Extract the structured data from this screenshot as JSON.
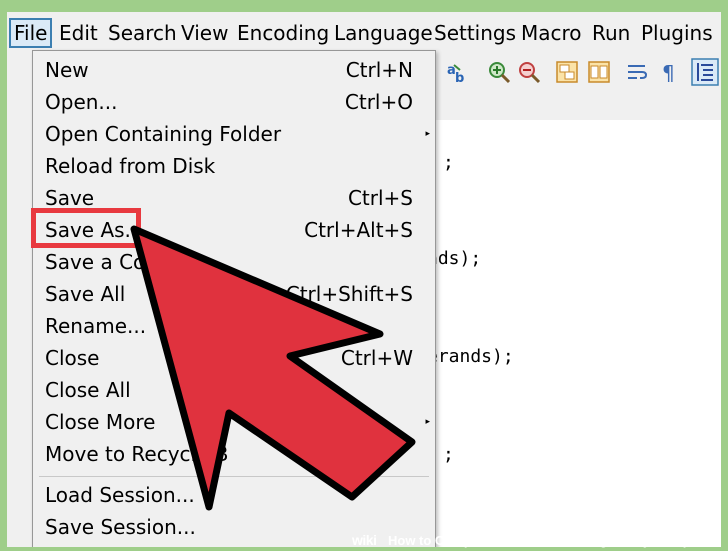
{
  "menubar": {
    "items": [
      "File",
      "Edit",
      "Search",
      "View",
      "Encoding",
      "Language",
      "Settings",
      "Macro",
      "Run",
      "Plugins"
    ],
    "active": "File"
  },
  "toolbar": {
    "icons": [
      "find-replace-icon",
      "zoom-in-icon",
      "zoom-out-icon",
      "sync-vertical-icon",
      "sync-horizontal-icon",
      "word-wrap-icon",
      "show-all-characters-icon",
      "indent-guide-icon"
    ]
  },
  "editor": {
    "lines": [
      ";",
      "nds);",
      "erands);",
      ";"
    ]
  },
  "file_menu": {
    "items": [
      {
        "label": "New",
        "shortcut": "Ctrl+N"
      },
      {
        "label": "Open...",
        "shortcut": "Ctrl+O"
      },
      {
        "label": "Open Containing Folder",
        "shortcut": "",
        "submenu": "▸"
      },
      {
        "label": "Reload from Disk",
        "shortcut": ""
      },
      {
        "label": "Save",
        "shortcut": "Ctrl+S"
      },
      {
        "label": "Save As...",
        "shortcut": "Ctrl+Alt+S"
      },
      {
        "label": "Save a Cop",
        "shortcut": ""
      },
      {
        "label": "Save All",
        "shortcut": "Ctrl+Shift+S"
      },
      {
        "label": "Rename...",
        "shortcut": ""
      },
      {
        "label": "Close",
        "shortcut": "Ctrl+W"
      },
      {
        "label": "Close All",
        "shortcut": ""
      },
      {
        "label": "Close More",
        "shortcut": "",
        "submenu": "▸"
      },
      {
        "label": "Move to Recycle B",
        "shortcut": ""
      },
      {
        "label": "Load Session...",
        "shortcut": ""
      },
      {
        "label": "Save Session...",
        "shortcut": ""
      }
    ]
  },
  "annotation": {
    "highlight_color": "#e8393f",
    "arrow_color": "#e0323e"
  },
  "footer": {
    "logo": "wiki",
    "text": "How to Compile and Run Java Program by Notepad"
  }
}
